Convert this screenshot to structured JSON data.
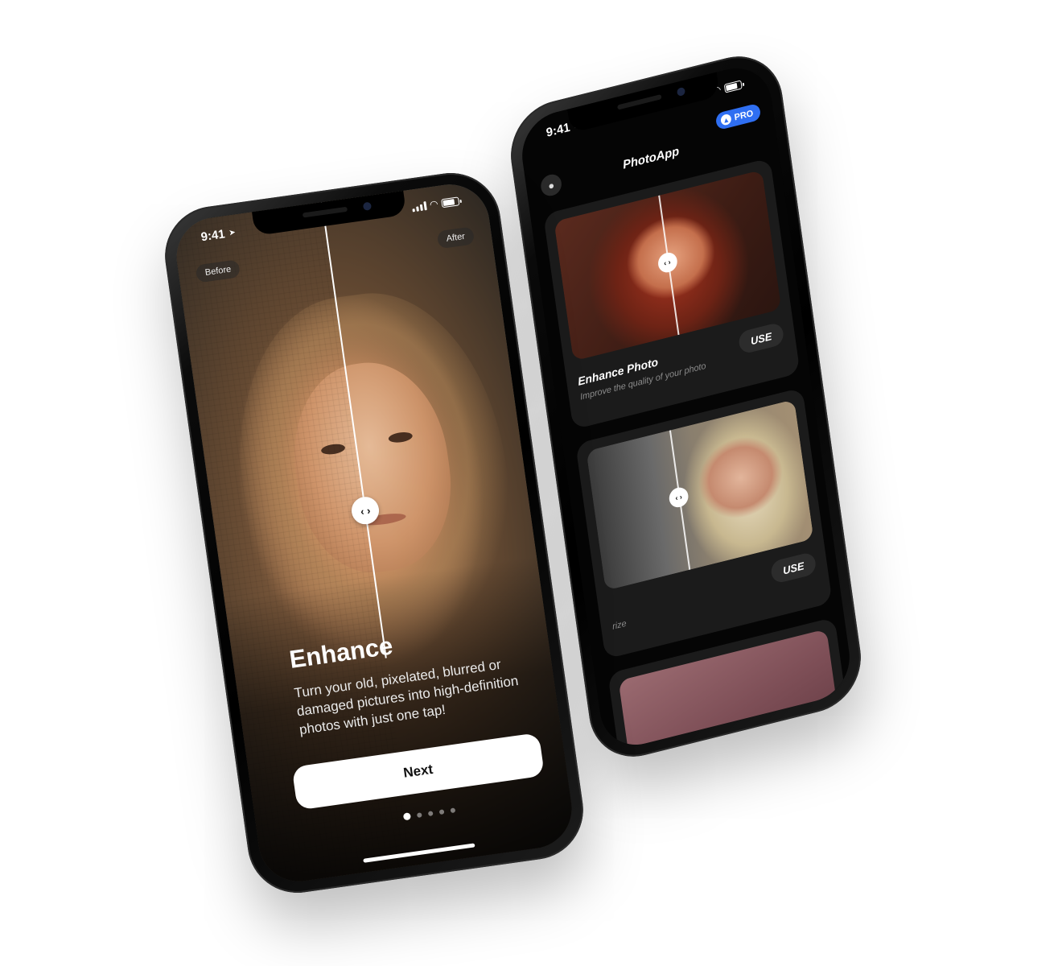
{
  "front_phone": {
    "status": {
      "time": "9:41"
    },
    "compare": {
      "before_label": "Before",
      "after_label": "After",
      "handle_icon": "left-right-arrows-icon"
    },
    "onboarding": {
      "title": "Enhance",
      "description": "Turn your old, pixelated, blurred or damaged pictures into high-definition photos with just one tap!",
      "next_label": "Next",
      "page_count": 5,
      "active_page": 1
    }
  },
  "back_phone": {
    "status": {
      "time": "9:41"
    },
    "header": {
      "title": "PhotoApp",
      "pro_label": "PRO",
      "profile_icon": "user-icon",
      "pro_icon": "arrow-up-icon"
    },
    "cards": [
      {
        "title": "Enhance Photo",
        "subtitle": "Improve the quality of your photo",
        "action": "USE"
      },
      {
        "title": "",
        "subtitle": "rize",
        "action": "USE"
      }
    ]
  }
}
